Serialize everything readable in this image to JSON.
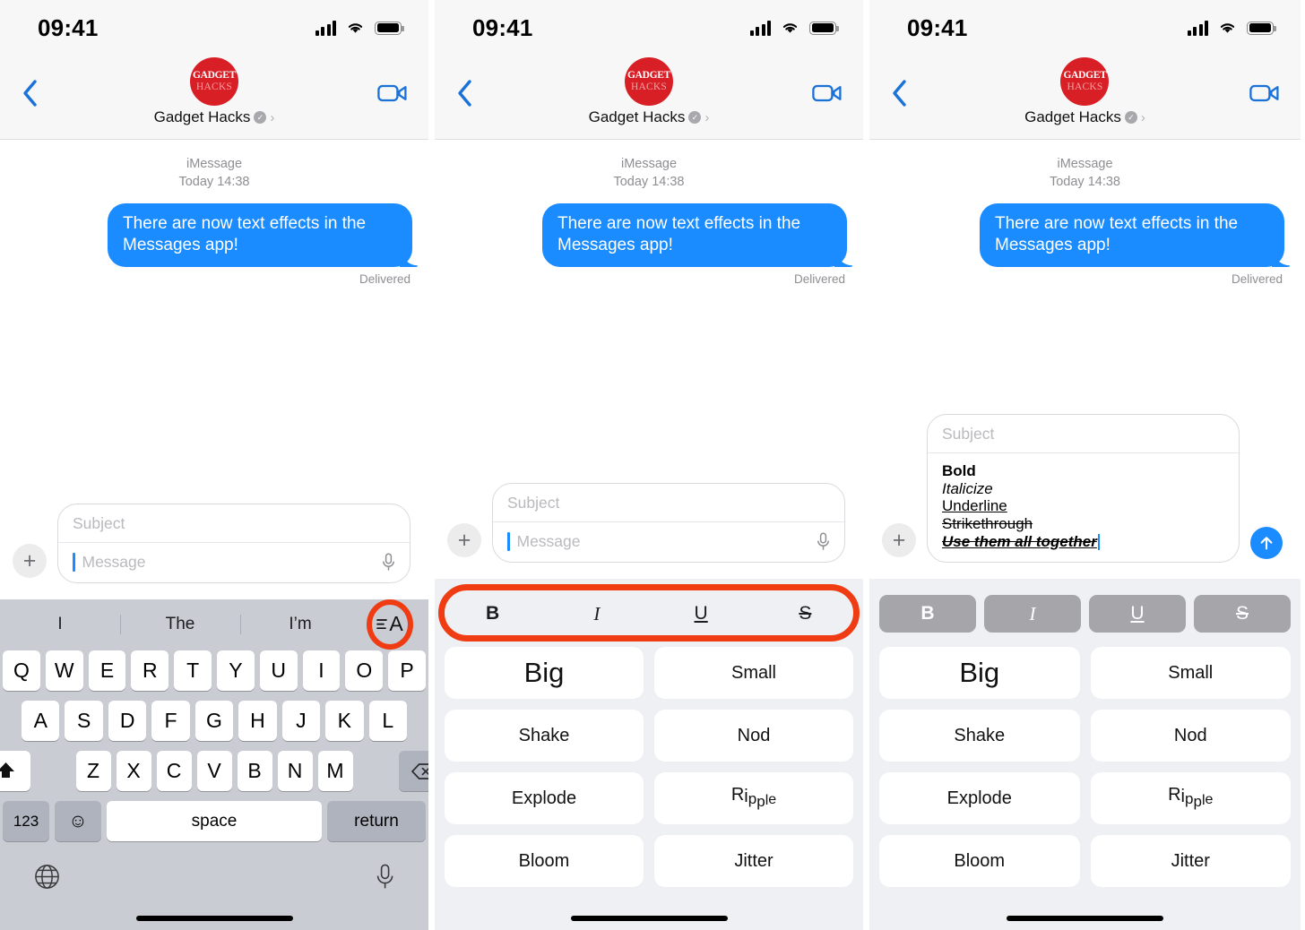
{
  "colors": {
    "accent_blue": "#1a8cff",
    "annotation_red": "#f03c12",
    "avatar_red": "#d91f26",
    "keyboard_gray": "#c9ccd3",
    "effects_bg": "#eef0f4"
  },
  "status_bar": {
    "time": "09:41",
    "cellular": "signal-bars-icon",
    "wifi": "wifi-icon",
    "battery": "battery-full-icon"
  },
  "nav": {
    "back_icon": "chevron-left-icon",
    "video_icon": "video-camera-icon",
    "avatar": {
      "line1": "GADGET",
      "line2": "HACKS"
    },
    "contact_name": "Gadget Hacks",
    "verified_badge": "verified-check-icon",
    "detail_chevron": "chevron-right-icon"
  },
  "conversation": {
    "service": "iMessage",
    "timestamp": "Today 14:38",
    "bubble_text": "There are now text effects in the Messages app!",
    "status": "Delivered"
  },
  "composer": {
    "plus_icon": "plus-icon",
    "subject_placeholder": "Subject",
    "message_placeholder": "Message",
    "mic_icon": "microphone-icon",
    "send_icon": "send-arrow-up-icon"
  },
  "rich_message": {
    "lines": [
      {
        "text": "Bold",
        "style": "bold"
      },
      {
        "text": "Italicize",
        "style": "italic"
      },
      {
        "text": "Underline",
        "style": "underline"
      },
      {
        "text": "Strikethrough",
        "style": "strikethrough"
      },
      {
        "text": "Use them all together",
        "style": "all"
      }
    ]
  },
  "keyboard": {
    "predictions": [
      "I",
      "The",
      "I’m"
    ],
    "format_button_icon": "text-format-icon",
    "format_button_label": "≡A",
    "row1": [
      "Q",
      "W",
      "E",
      "R",
      "T",
      "Y",
      "U",
      "I",
      "O",
      "P"
    ],
    "row2": [
      "A",
      "S",
      "D",
      "F",
      "G",
      "H",
      "J",
      "K",
      "L"
    ],
    "row3": [
      "Z",
      "X",
      "C",
      "V",
      "B",
      "N",
      "M"
    ],
    "shift_icon": "shift-arrow-up-icon",
    "backspace_icon": "backspace-delete-icon",
    "numbers_key": "123",
    "emoji_icon": "emoji-smiley-icon",
    "space_key": "space",
    "return_key": "return",
    "globe_icon": "globe-language-icon",
    "dictation_icon": "microphone-icon"
  },
  "style_bar": {
    "buttons": [
      {
        "label": "B",
        "name": "bold"
      },
      {
        "label": "I",
        "name": "italic"
      },
      {
        "label": "U",
        "name": "underline"
      },
      {
        "label": "S",
        "name": "strikethrough"
      }
    ]
  },
  "effects": {
    "items": [
      "Big",
      "Small",
      "Shake",
      "Nod",
      "Explode",
      "Ripple",
      "Bloom",
      "Jitter"
    ]
  }
}
